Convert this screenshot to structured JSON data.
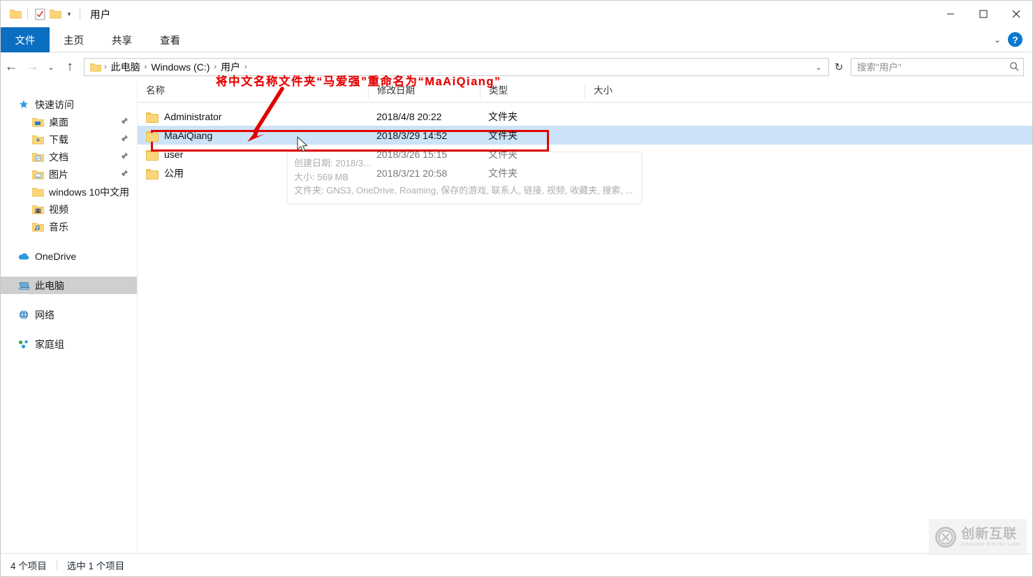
{
  "window": {
    "title": "用户",
    "quick_access": [
      {
        "name": "folder-icon",
        "glyph": "folder"
      },
      {
        "name": "properties-icon",
        "glyph": "properties"
      },
      {
        "name": "new-folder-icon",
        "glyph": "folder"
      }
    ],
    "controls": {
      "minimize": "─",
      "maximize": "□",
      "close": "✕"
    }
  },
  "ribbon": {
    "tabs": [
      {
        "label": "文件",
        "active": true
      },
      {
        "label": "主页",
        "active": false
      },
      {
        "label": "共享",
        "active": false
      },
      {
        "label": "查看",
        "active": false
      }
    ],
    "collapse_icon": "⌄",
    "help_icon": "?"
  },
  "addressbar": {
    "back_icon": "←",
    "forward_icon": "→",
    "recent_icon": "⌄",
    "up_icon": "↑",
    "crumbs": [
      "此电脑",
      "Windows (C:)",
      "用户"
    ],
    "crumb_sep": "›",
    "dropdown_icon": "⌄",
    "refresh_icon": "↻"
  },
  "search": {
    "placeholder": "搜索\"用户\"",
    "value": "",
    "icon": "⌕"
  },
  "sidebar": {
    "items": [
      {
        "label": "快速访问",
        "icon": "star-pin",
        "level": "root",
        "pinned": false,
        "selected": false
      },
      {
        "label": "桌面",
        "icon": "desktop-folder",
        "level": "child",
        "pinned": true,
        "selected": false
      },
      {
        "label": "下载",
        "icon": "downloads-folder",
        "level": "child",
        "pinned": true,
        "selected": false
      },
      {
        "label": "文档",
        "icon": "documents-folder",
        "level": "child",
        "pinned": true,
        "selected": false
      },
      {
        "label": "图片",
        "icon": "pictures-folder",
        "level": "child",
        "pinned": true,
        "selected": false
      },
      {
        "label": "windows 10中文用",
        "icon": "folder",
        "level": "child",
        "pinned": false,
        "selected": false
      },
      {
        "label": "视频",
        "icon": "videos-folder",
        "level": "child",
        "pinned": false,
        "selected": false
      },
      {
        "label": "音乐",
        "icon": "music-folder",
        "level": "child",
        "pinned": false,
        "selected": false
      },
      {
        "label": "OneDrive",
        "icon": "cloud",
        "level": "root",
        "pinned": false,
        "selected": false
      },
      {
        "label": "此电脑",
        "icon": "computer",
        "level": "root",
        "pinned": false,
        "selected": true
      },
      {
        "label": "网络",
        "icon": "network",
        "level": "root",
        "pinned": false,
        "selected": false
      },
      {
        "label": "家庭组",
        "icon": "homegroup",
        "level": "root",
        "pinned": false,
        "selected": false
      }
    ]
  },
  "filelist": {
    "columns": [
      "名称",
      "修改日期",
      "类型",
      "大小"
    ],
    "rows": [
      {
        "name": "Administrator",
        "date": "2018/4/8 20:22",
        "type": "文件夹",
        "size": "",
        "selected": false
      },
      {
        "name": "MaAiQiang",
        "date": "2018/3/29 14:52",
        "type": "文件夹",
        "size": "",
        "selected": true
      },
      {
        "name": "user",
        "date": "2018/3/26 15:15",
        "type": "文件夹",
        "size": "",
        "selected": false
      },
      {
        "name": "公用",
        "date": "2018/3/21 20:58",
        "type": "文件夹",
        "size": "",
        "selected": false
      }
    ]
  },
  "tooltip": {
    "created": "创建日期: 2018/3...",
    "size": "大小: 569 MB",
    "folders": "文件夹: GNS3, OneDrive, Roaming, 保存的游戏, 联系人, 链接, 视频, 收藏夹, 搜索, ..."
  },
  "annotation": {
    "text": "将中文名称文件夹“马爱强”重命名为“MaAiQiang”",
    "color": "#e00000"
  },
  "status": {
    "item_count": "4 个项目",
    "selected_count": "选中 1 个项目"
  },
  "watermark": {
    "mark": "C",
    "cn": "创新互联",
    "en": "CHUANG XIN HU LIAN"
  }
}
